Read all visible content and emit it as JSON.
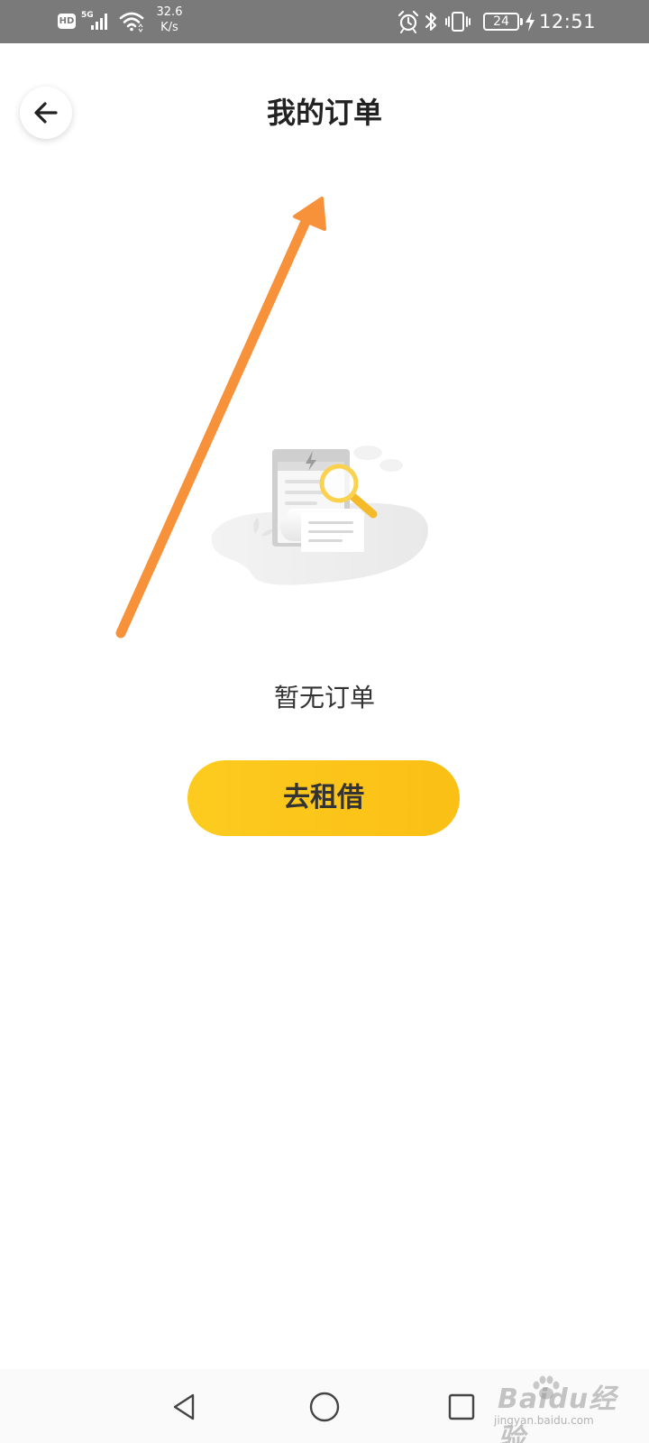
{
  "status_bar": {
    "hd_badge": "HD",
    "network_type": "5G",
    "speed_value": "32.6",
    "speed_unit": "K/s",
    "battery_level": "24",
    "time": "12:51",
    "icons": [
      "signal-icon",
      "wifi-icon",
      "alarm-icon",
      "bluetooth-icon",
      "vibrate-icon",
      "battery-icon",
      "charging-icon"
    ]
  },
  "header": {
    "back_icon": "arrow-left-icon",
    "title": "我的订单"
  },
  "empty_state": {
    "illustration": "empty-orders-illustration",
    "message": "暂无订单",
    "action_label": "去租借"
  },
  "annotation": {
    "icon": "annotation-arrow-icon",
    "color": "#F7923A"
  },
  "navigation_bar": {
    "items": [
      {
        "icon": "back-triangle-icon"
      },
      {
        "icon": "home-circle-icon"
      },
      {
        "icon": "recents-square-icon"
      }
    ]
  },
  "watermark": {
    "brand": "Baidu经验",
    "subtext": "jingyan.baidu.com"
  },
  "colors": {
    "status_bar_bg": "#7A7A7A",
    "accent": "#FCC71F",
    "title_text": "#222222",
    "body_text": "#333333"
  }
}
